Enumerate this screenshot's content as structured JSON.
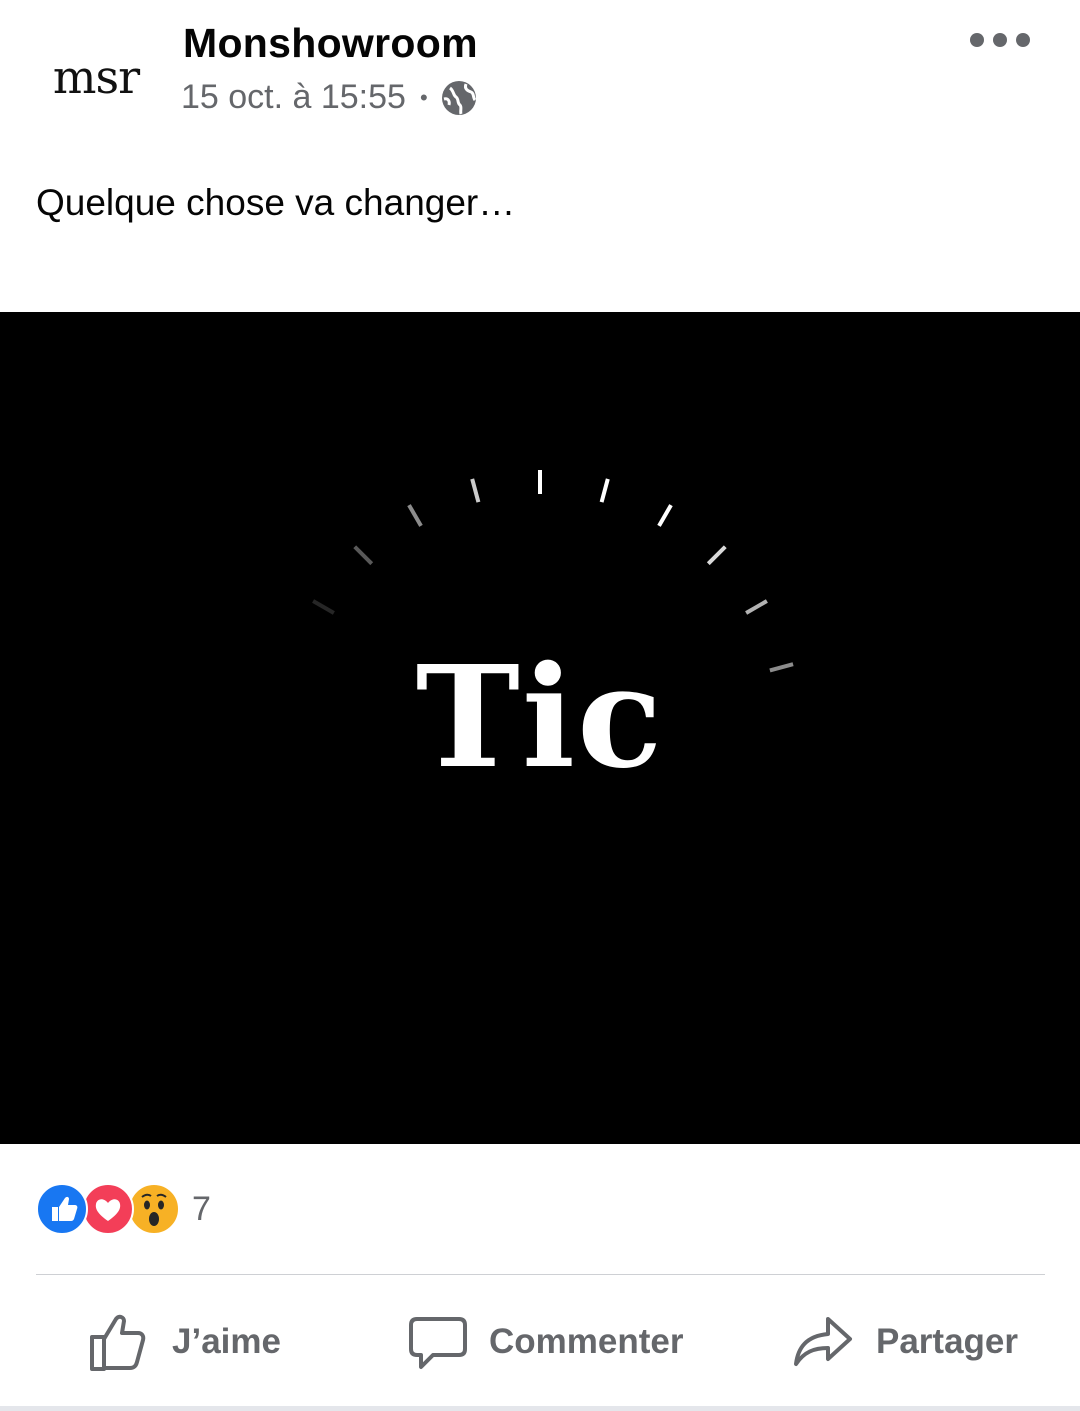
{
  "post": {
    "page_name": "Monshowroom",
    "avatar_text": "msr",
    "timestamp": "15 oct. à 15:55",
    "separator": "•",
    "audience_icon": "globe-icon",
    "more_icon": "more-horizontal-icon",
    "caption": "Quelque chose va changer…"
  },
  "media": {
    "title_text": "Tic",
    "background": "#000000"
  },
  "reactions": {
    "icons": [
      "like-icon",
      "love-icon",
      "wow-icon"
    ],
    "count": "7"
  },
  "actions": {
    "like_label": "J’aime",
    "comment_label": "Commenter",
    "share_label": "Partager"
  },
  "colors": {
    "text_primary": "#050505",
    "text_secondary": "#65676b",
    "like_blue": "#1877f2",
    "love_red": "#f33e58",
    "wow_yellow": "#f7b125"
  }
}
